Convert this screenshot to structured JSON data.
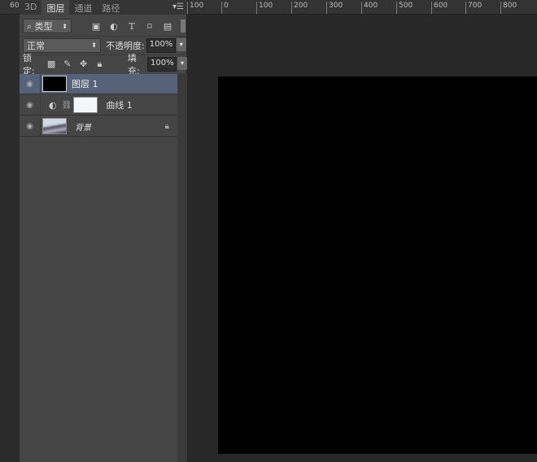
{
  "left_ruler": {
    "label": "60"
  },
  "panel": {
    "tabs": [
      {
        "label": "3D"
      },
      {
        "label": "图层",
        "active": true
      },
      {
        "label": "通道"
      },
      {
        "label": "路径"
      }
    ],
    "menu_icon": "panel-menu-icon",
    "filter": {
      "kind": "类型",
      "icons": [
        "image-filter-icon",
        "adjustment-filter-icon",
        "type-filter-icon",
        "shape-filter-icon",
        "smart-object-filter-icon"
      ]
    },
    "blend_mode": "正常",
    "opacity_label": "不透明度:",
    "opacity": "100%",
    "lock_label": "锁定:",
    "lock_icons": [
      "lock-transparent-icon",
      "lock-paint-icon",
      "lock-move-icon",
      "lock-all-icon"
    ],
    "fill_label": "填充:",
    "fill": "100%",
    "layers": [
      {
        "name": "图层 1",
        "selected": true,
        "thumb": "#000000"
      },
      {
        "name": "曲线 1",
        "type": "adjustment",
        "mask": "#f4f8fb"
      },
      {
        "name": "背景",
        "locked": true
      }
    ]
  },
  "ruler": {
    "ticks": [
      "100",
      "0",
      "100",
      "200",
      "300",
      "400",
      "500",
      "600",
      "700",
      "800"
    ]
  },
  "colors": {
    "selected_layer": "#556277",
    "document": "#000000"
  }
}
